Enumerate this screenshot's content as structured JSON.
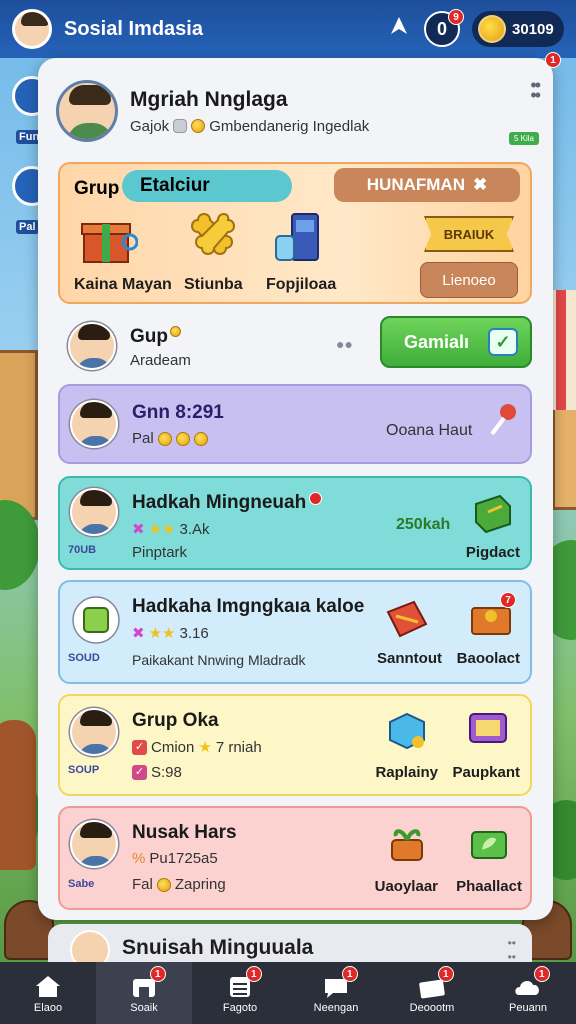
{
  "header": {
    "app_title": "Sosial Imdasia",
    "counter": "0",
    "counter_badge": "9",
    "coins": "30109"
  },
  "side_labels": [
    "Fun",
    "Pal"
  ],
  "profile": {
    "name": "Mgriah Nnglaga",
    "sub_prefix": "Gajok",
    "sub_text": "Gmbendanerig Ingedlak",
    "tag": "5 Kila",
    "panel_badge": "1"
  },
  "grup": {
    "label": "Grup",
    "pill": "Etalciur",
    "right_label": "HUNAFMAN",
    "items": [
      {
        "label": "Kaina Mayan",
        "icon": "gift-box-icon"
      },
      {
        "label": "Stiunba",
        "icon": "bone-icon"
      },
      {
        "label": "Fopjiloaa",
        "icon": "potion-icon"
      }
    ],
    "ribbon": "BRAIUK",
    "button": "Lienoeo"
  },
  "rows": [
    {
      "title": "Gup",
      "sub": "Aradeam",
      "button": "Gamialı",
      "bg": "#f2f4f8"
    },
    {
      "title": "Gnn 8:291",
      "sub": "Pal",
      "right_text": "Ooana Haut",
      "bg": "#c9c0f2"
    },
    {
      "title": "Hadkah Mingneuah",
      "rating": "3.Ak",
      "sub": "Pinptark",
      "side": "70UB",
      "points": "250kah",
      "item_label": "Pigdact",
      "bg": "#7fdcd8"
    },
    {
      "title": "Hadkaha Imgngkaıa kaloe",
      "rating": "3.16",
      "sub": "Paikakant Nnwing Mladradk",
      "side": "SOUD",
      "items": [
        {
          "label": "Sanntout",
          "icon": "ribbon-box-icon"
        },
        {
          "label": "Baoolact",
          "icon": "chest-icon",
          "badge": "7"
        }
      ],
      "bg": "#d2ecfb"
    },
    {
      "title": "Grup Oka",
      "line1": "Cmion",
      "line1b": "7 rniah",
      "line2": "S:98",
      "side": "SOUP",
      "items": [
        {
          "label": "Raplainy",
          "icon": "cube-icon"
        },
        {
          "label": "Paupkant",
          "icon": "frame-icon"
        }
      ],
      "bg": "#fdf6c6"
    },
    {
      "title": "Nusak Hars",
      "line1": "Pu1725a5",
      "line2": "Fal",
      "line2b": "Zapring",
      "side": "Sabe",
      "items": [
        {
          "label": "Uaoylaar",
          "icon": "plant-pot-icon"
        },
        {
          "label": "Phaallact",
          "icon": "leaf-card-icon"
        }
      ],
      "bg": "#fcd2d0"
    }
  ],
  "peek": {
    "title": "Snuisah Minguuala"
  },
  "nav": [
    {
      "label": "Elaoo",
      "icon": "home-icon",
      "badge": ""
    },
    {
      "label": "Soaik",
      "icon": "social-icon",
      "badge": "1",
      "active": true
    },
    {
      "label": "Fagoto",
      "icon": "calendar-icon",
      "badge": "1"
    },
    {
      "label": "Neengan",
      "icon": "chat-icon",
      "badge": "1"
    },
    {
      "label": "Deoootm",
      "icon": "news-icon",
      "badge": "1"
    },
    {
      "label": "Peuann",
      "icon": "cloud-icon",
      "badge": "1"
    }
  ]
}
